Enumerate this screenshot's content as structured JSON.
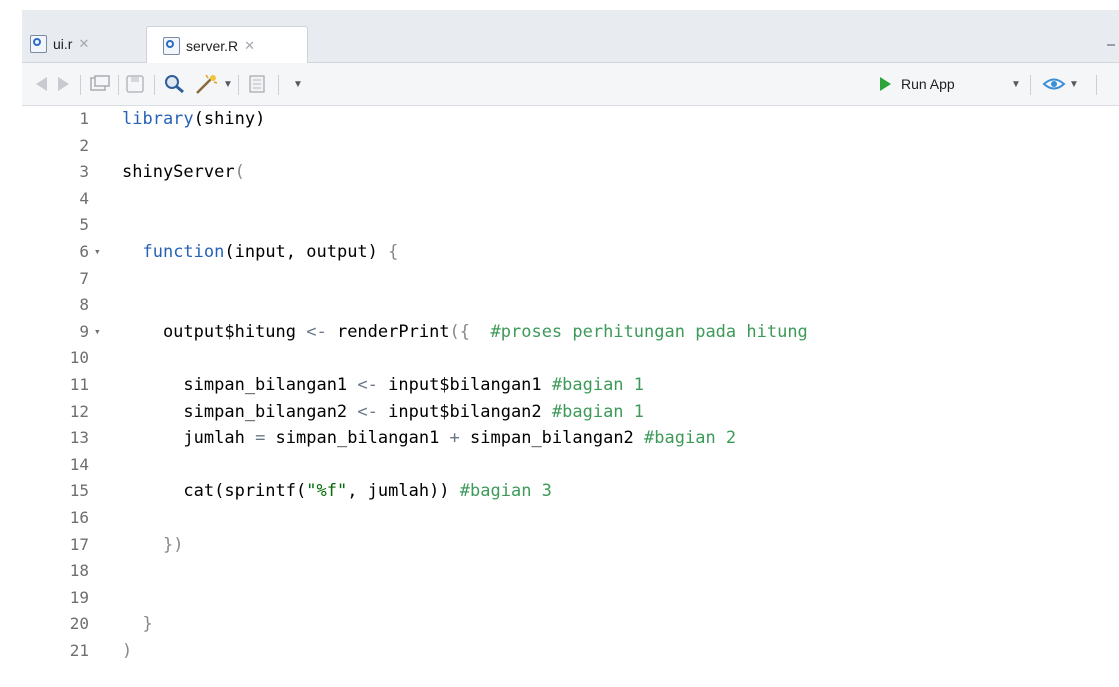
{
  "tabs": [
    {
      "label": "ui.r",
      "active": false
    },
    {
      "label": "server.R",
      "active": true
    }
  ],
  "toolbar": {
    "run_app_label": "Run App"
  },
  "editor": {
    "lines": [
      {
        "n": "1",
        "fold": "",
        "tokens": [
          [
            "kw",
            "library"
          ],
          [
            "tx",
            "(shiny)"
          ]
        ]
      },
      {
        "n": "2",
        "fold": "",
        "tokens": []
      },
      {
        "n": "3",
        "fold": "",
        "tokens": [
          [
            "tx",
            "shinyServer"
          ],
          [
            "br",
            "("
          ]
        ]
      },
      {
        "n": "4",
        "fold": "",
        "tokens": []
      },
      {
        "n": "5",
        "fold": "",
        "tokens": []
      },
      {
        "n": "6",
        "fold": "▾",
        "tokens": [
          [
            "tx",
            "  "
          ],
          [
            "kw",
            "function"
          ],
          [
            "tx",
            "(input, output) "
          ],
          [
            "br",
            "{"
          ]
        ]
      },
      {
        "n": "7",
        "fold": "",
        "tokens": []
      },
      {
        "n": "8",
        "fold": "",
        "tokens": []
      },
      {
        "n": "9",
        "fold": "▾",
        "tokens": [
          [
            "tx",
            "    output$hitung "
          ],
          [
            "op",
            "<-"
          ],
          [
            "tx",
            " renderPrint"
          ],
          [
            "br",
            "({"
          ],
          [
            "tx",
            "  "
          ],
          [
            "cm",
            "#proses perhitungan pada hitung"
          ]
        ]
      },
      {
        "n": "10",
        "fold": "",
        "tokens": []
      },
      {
        "n": "11",
        "fold": "",
        "tokens": [
          [
            "tx",
            "      simpan_bilangan1 "
          ],
          [
            "op",
            "<-"
          ],
          [
            "tx",
            " input$bilangan1 "
          ],
          [
            "cm",
            "#bagian 1"
          ]
        ]
      },
      {
        "n": "12",
        "fold": "",
        "tokens": [
          [
            "tx",
            "      simpan_bilangan2 "
          ],
          [
            "op",
            "<-"
          ],
          [
            "tx",
            " input$bilangan2 "
          ],
          [
            "cm",
            "#bagian 1"
          ]
        ]
      },
      {
        "n": "13",
        "fold": "",
        "tokens": [
          [
            "tx",
            "      jumlah "
          ],
          [
            "op",
            "="
          ],
          [
            "tx",
            " simpan_bilangan1 "
          ],
          [
            "op",
            "+"
          ],
          [
            "tx",
            " simpan_bilangan2 "
          ],
          [
            "cm",
            "#bagian 2"
          ]
        ]
      },
      {
        "n": "14",
        "fold": "",
        "tokens": []
      },
      {
        "n": "15",
        "fold": "",
        "tokens": [
          [
            "tx",
            "      cat(sprintf("
          ],
          [
            "st",
            "\"%f\""
          ],
          [
            "tx",
            ", jumlah)) "
          ],
          [
            "cm",
            "#bagian 3"
          ]
        ]
      },
      {
        "n": "16",
        "fold": "",
        "tokens": []
      },
      {
        "n": "17",
        "fold": "",
        "tokens": [
          [
            "tx",
            "    "
          ],
          [
            "br",
            "})"
          ]
        ]
      },
      {
        "n": "18",
        "fold": "",
        "tokens": []
      },
      {
        "n": "19",
        "fold": "",
        "tokens": []
      },
      {
        "n": "20",
        "fold": "",
        "tokens": [
          [
            "tx",
            "  "
          ],
          [
            "br",
            "}"
          ]
        ]
      },
      {
        "n": "21",
        "fold": "",
        "tokens": [
          [
            "br",
            ")"
          ]
        ]
      }
    ]
  },
  "icons": {
    "back": "back-arrow-icon",
    "forward": "forward-arrow-icon",
    "show-in-window": "show-in-window-icon",
    "save": "save-icon",
    "find": "search-icon",
    "code-tools": "magic-wand-icon",
    "compile-report": "notebook-icon",
    "run-app": "play-icon",
    "publish": "publish-icon"
  },
  "colors": {
    "keyword": "#2762b8",
    "comment": "#3d9a59",
    "string": "#036a07",
    "run": "#2ea33a"
  }
}
